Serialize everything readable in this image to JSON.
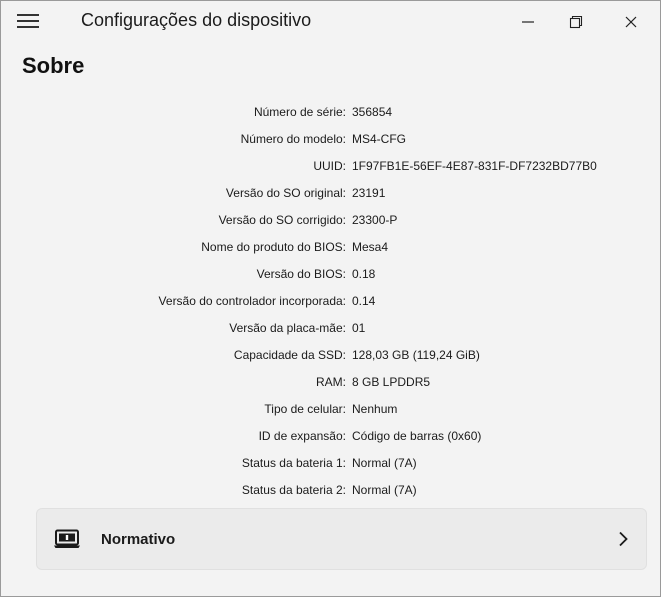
{
  "window": {
    "title": "Configurações do dispositivo",
    "menu_icon": "hamburger-menu-icon",
    "controls": [
      "minimize-icon",
      "maximize-icon",
      "close-icon"
    ]
  },
  "page": {
    "title": "Sobre"
  },
  "info": [
    {
      "label": "Número de série:",
      "value": "356854"
    },
    {
      "label": "Número do modelo:",
      "value": "MS4-CFG"
    },
    {
      "label": "UUID:",
      "value": "1F97FB1E-56EF-4E87-831F-DF7232BD77B0"
    },
    {
      "label": "Versão do SO original:",
      "value": "23191"
    },
    {
      "label": "Versão do SO corrigido:",
      "value": "23300-P"
    },
    {
      "label": "Nome do produto do BIOS:",
      "value": "Mesa4"
    },
    {
      "label": "Versão do BIOS:",
      "value": "0.18"
    },
    {
      "label": "Versão do controlador incorporada:",
      "value": "0.14"
    },
    {
      "label": "Versão da placa-mãe:",
      "value": "01"
    },
    {
      "label": "Capacidade da SSD:",
      "value": "128,03 GB (119,24 GiB)"
    },
    {
      "label": "RAM:",
      "value": "8 GB LPDDR5"
    },
    {
      "label": "Tipo de celular:",
      "value": "Nenhum"
    },
    {
      "label": "ID de expansão:",
      "value": "Código de barras (0x60)"
    },
    {
      "label": "Status da bateria 1:",
      "value": "Normal (7A)"
    },
    {
      "label": "Status da bateria 2:",
      "value": "Normal (7A)"
    }
  ],
  "regulatory": {
    "label": "Normativo",
    "icon": "regulatory-info-icon",
    "chevron": "chevron-right-icon"
  }
}
